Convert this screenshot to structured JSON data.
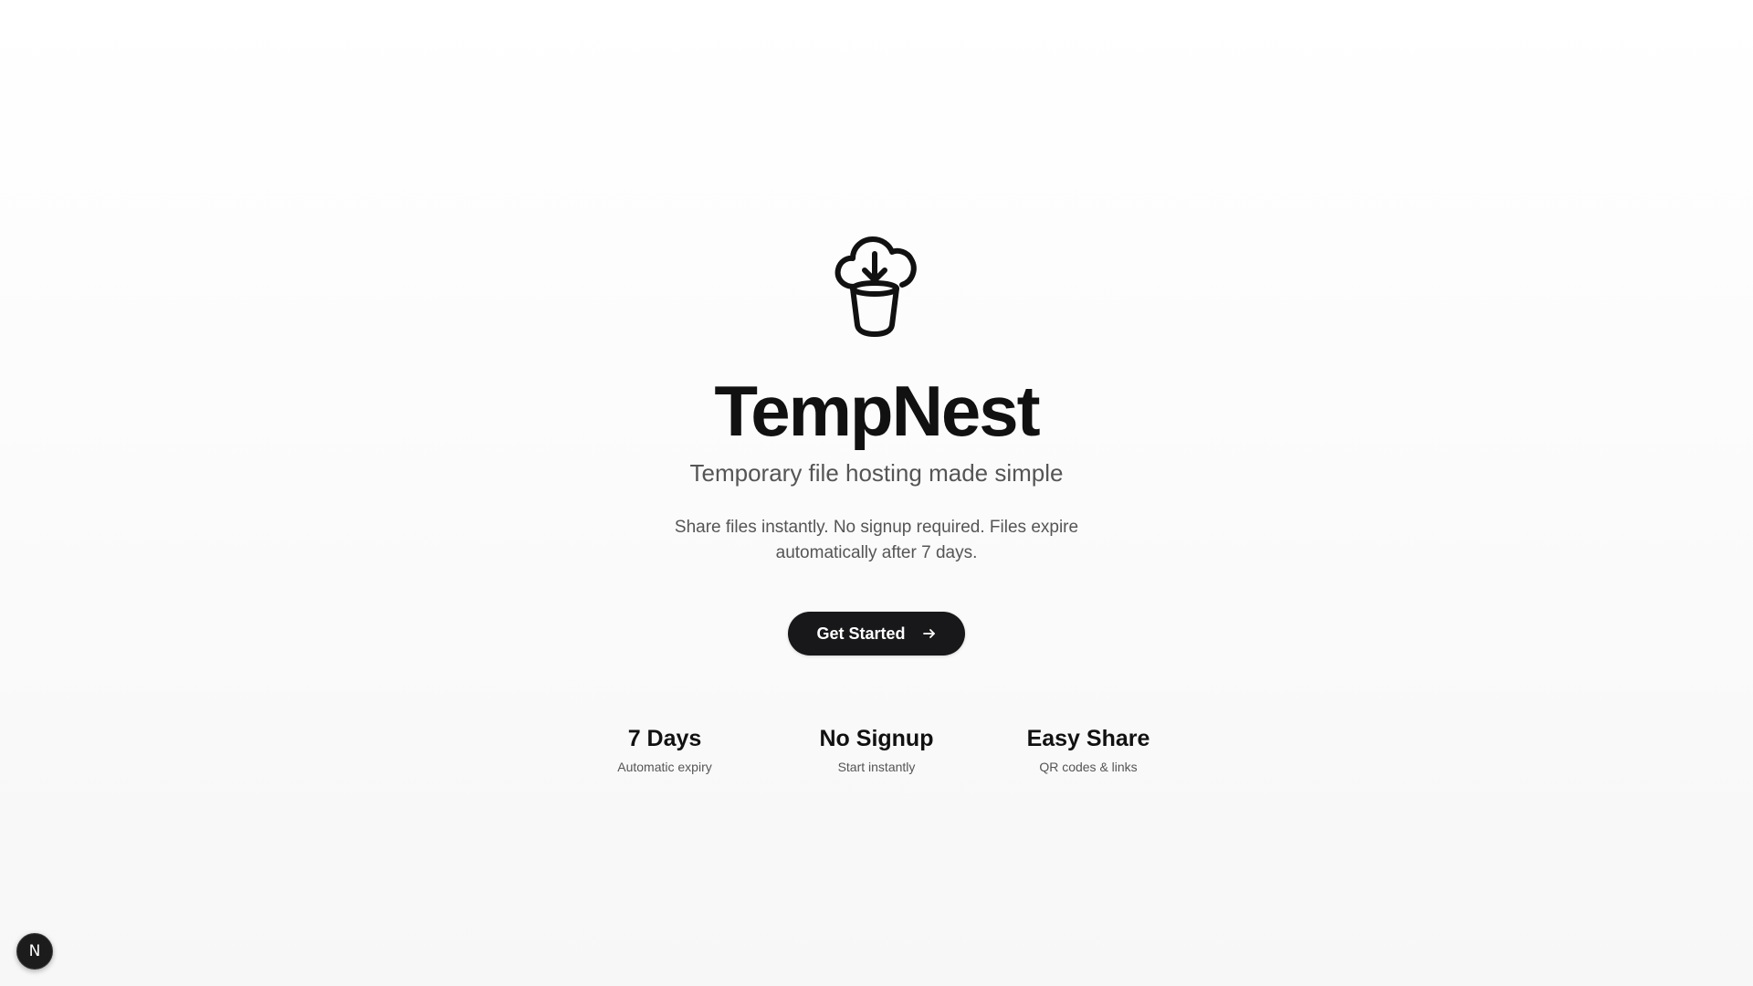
{
  "brand": {
    "name": "TempNest",
    "logo_icon": "cloud-download-bucket-icon",
    "tagline": "Temporary file hosting made simple",
    "description": "Share files instantly. No signup required. Files expire automatically after 7 days."
  },
  "cta": {
    "label": "Get Started",
    "icon": "arrow-right-icon"
  },
  "features": [
    {
      "title": "7 Days",
      "subtitle": "Automatic expiry"
    },
    {
      "title": "No Signup",
      "subtitle": "Start instantly"
    },
    {
      "title": "Easy Share",
      "subtitle": "QR codes & links"
    }
  ],
  "dev_badge": {
    "label": "N"
  },
  "colors": {
    "text_primary": "#111111",
    "text_secondary": "#555555",
    "button_bg": "#18181a",
    "button_text": "#ffffff",
    "page_bg": "#fbfbfb"
  }
}
